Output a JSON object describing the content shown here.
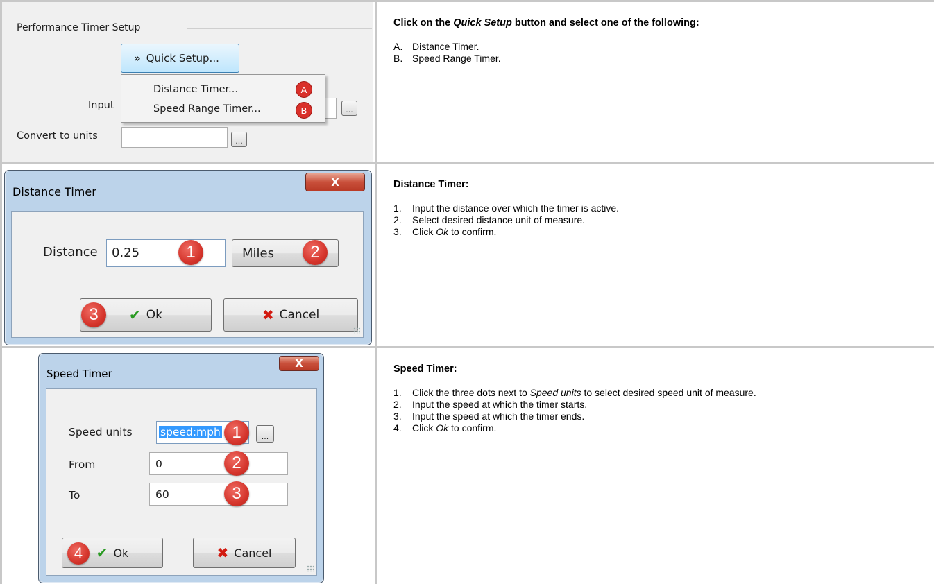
{
  "row1": {
    "panel": {
      "group_title": "Performance Timer Setup",
      "quick_setup_button": "Quick Setup...",
      "menu": [
        {
          "label": "Distance Timer...",
          "badge": "A"
        },
        {
          "label": "Speed Range Timer...",
          "badge": "B"
        }
      ],
      "input_label": "Input",
      "convert_label": "Convert to units",
      "convert_value": "",
      "ellipsis": "..."
    },
    "text": {
      "heading_pre": "Click on the ",
      "heading_em": "Quick Setup",
      "heading_post": " button and select one of the following:",
      "items": [
        {
          "num": "A.",
          "text": "Distance Timer."
        },
        {
          "num": "B.",
          "text": "Speed Range Timer."
        }
      ]
    }
  },
  "row2": {
    "dialog": {
      "title": "Distance Timer",
      "close": "X",
      "distance_label": "Distance",
      "distance_value": "0.25",
      "unit_value": "Miles",
      "ok_label": "Ok",
      "cancel_label": "Cancel",
      "callouts": [
        "1",
        "2",
        "3"
      ]
    },
    "text": {
      "heading": "Distance Timer:",
      "items": [
        {
          "num": "1.",
          "text": "Input the distance over which the timer is active."
        },
        {
          "num": "2.",
          "text": "Select desired distance unit of measure."
        },
        {
          "num": "3.",
          "pre": "Click ",
          "em": "Ok",
          "post": " to confirm."
        }
      ]
    }
  },
  "row3": {
    "dialog": {
      "title": "Speed Timer",
      "close": "X",
      "speed_units_label": "Speed units",
      "speed_units_value": "speed:mph",
      "from_label": "From",
      "from_value": "0",
      "to_label": "To",
      "to_value": "60",
      "ellipsis": "...",
      "ok_label": "Ok",
      "cancel_label": "Cancel",
      "callouts": [
        "1",
        "2",
        "3",
        "4"
      ]
    },
    "text": {
      "heading": "Speed Timer:",
      "items": [
        {
          "num": "1.",
          "pre": "Click the three dots next to ",
          "em": "Speed units",
          "post": " to select desired speed unit of measure."
        },
        {
          "num": "2.",
          "text": "Input the speed at which the timer starts."
        },
        {
          "num": "3.",
          "text": "Input the speed at which the timer ends."
        },
        {
          "num": "4.",
          "pre": "Click ",
          "em": "Ok",
          "post": " to confirm."
        }
      ]
    }
  },
  "colors": {
    "callout_red": "#d5352c",
    "check_green": "#2a9a23",
    "cancel_red": "#d21a10",
    "selection_blue": "#3399ff",
    "grid_gray": "#c8c8c8"
  }
}
